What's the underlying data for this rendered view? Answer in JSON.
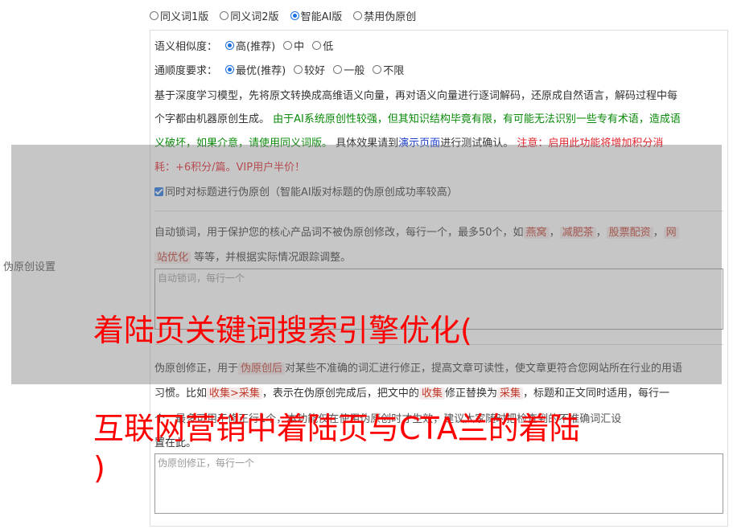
{
  "modes": [
    {
      "label": "同义词1版",
      "selected": false
    },
    {
      "label": "同义词2版",
      "selected": false
    },
    {
      "label": "智能AI版",
      "selected": true
    },
    {
      "label": "禁用伪原创",
      "selected": false
    }
  ],
  "similarity": {
    "label": "语义相似度：",
    "options": [
      {
        "label": "高(推荐)",
        "selected": true
      },
      {
        "label": "中",
        "selected": false
      },
      {
        "label": "低",
        "selected": false
      }
    ]
  },
  "fluency": {
    "label": "通顺度要求：",
    "options": [
      {
        "label": "最优(推荐)",
        "selected": true
      },
      {
        "label": "较好",
        "selected": false
      },
      {
        "label": "一般",
        "selected": false
      },
      {
        "label": "不限",
        "selected": false
      }
    ]
  },
  "description": {
    "line1": "基于深度学习模型，先将原文转换成高维语义向量，再对语义向量进行逐词解码，还原成自然语言，解码过程中每",
    "line2_plain": "个字都由机器原创生成。",
    "line2_green": "由于AI系统原创性较强，但其知识结构毕竟有限，有可能无法识别一些专有术语，造成语",
    "line3_green": "义破坏，如果介意，请使用同义词版。",
    "line3_plain_a": "具体效果请到",
    "line3_link": "演示页面",
    "line3_plain_b": "进行测试确认。",
    "line3_red": "注意：启用此功能将增加积分消",
    "line4_red": "耗：+6积分/篇。VIP用户半价！"
  },
  "title_option": {
    "label": "同时对标题进行伪原创（智能AI版对标题的伪原创成功率较高）",
    "checked": true
  },
  "side_label": "伪原创设置",
  "lock_words": {
    "text_a": "自动锁词，用于保护您的核心产品词不被伪原创修改，每行一个，最多50个，如",
    "tag1": "燕窝",
    "sep1": "，",
    "tag2": "减肥茶",
    "sep2": "，",
    "tag3": "股票配资",
    "sep3": "，",
    "tag4a": "网",
    "tag4b": "站优化",
    "text_b": "等等，并根据实际情况跟踪调整。",
    "placeholder": "自动锁词，每行一个"
  },
  "corrections": {
    "text_a": "伪原创修正，用于",
    "tag1": "伪原创后",
    "text_b": "对某些不准确的词汇进行修正，提高文章可读性，使文章更符合您网站所在行业的用语",
    "text_c": "习惯。比如",
    "tag2": "收集>采集",
    "text_d": "，表示在伪原创完成后，把文中的",
    "tag3": "收集",
    "text_e": "修正替换为",
    "tag4": "采集",
    "text_f": "，标题和正文同时适用，每行一",
    "text_g": "个，最多可用于修正行1个，本功能仅在使用伪原创时才生效，建议大家随时把检查到的不准确词汇设",
    "text_h": "置在此。",
    "placeholder": "伪原创修正，每行一个"
  },
  "headline": {
    "line1": "着陆页关键词搜索引擎优化(",
    "line2": "互联网营销中着陆页与CTA兰的着陆",
    "line3": ")"
  }
}
